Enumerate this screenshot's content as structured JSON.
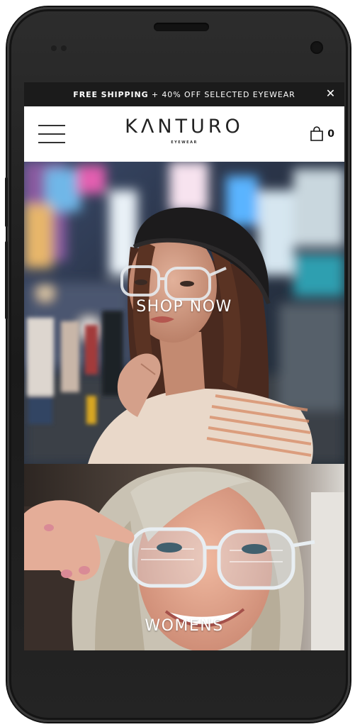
{
  "promo": {
    "bold_text": "FREE SHIPPING",
    "rest_text": " + 40% OFF SELECTED EYEWEAR",
    "close_glyph": "✕"
  },
  "header": {
    "menu_icon": "hamburger-menu-icon",
    "logo_name": "KΛNTURO",
    "logo_sub": "EYEWEAR",
    "cart_icon": "shopping-bag-icon",
    "cart_count": "0"
  },
  "panels": [
    {
      "label": "SHOP NOW"
    },
    {
      "label": "WOMENS"
    }
  ],
  "colors": {
    "promo_bar": "#1b1b1b",
    "text_dark": "#222222",
    "phone_body": "#222222"
  }
}
